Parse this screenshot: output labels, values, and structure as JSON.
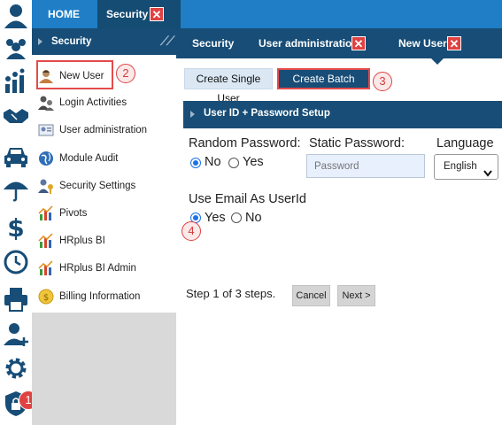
{
  "topbar": {
    "tabs": [
      {
        "label": "HOME"
      },
      {
        "label": "Security",
        "close": "✕"
      }
    ]
  },
  "sidebar": {
    "header": "Security",
    "items": [
      {
        "label": "New User",
        "icon": "user-icon"
      },
      {
        "label": "Login Activities",
        "icon": "users-icon"
      },
      {
        "label": "User administration",
        "icon": "id-card-icon"
      },
      {
        "label": "Module Audit",
        "icon": "globe-icon"
      },
      {
        "label": "Security Settings",
        "icon": "key-user-icon"
      },
      {
        "label": "Pivots",
        "icon": "chart-icon"
      },
      {
        "label": "HRplus BI",
        "icon": "chart-icon"
      },
      {
        "label": "HRplus BI Admin",
        "icon": "chart-icon"
      },
      {
        "label": "Billing Information",
        "icon": "coin-icon"
      }
    ]
  },
  "nav2": {
    "items": [
      {
        "label": "Security"
      },
      {
        "label": "User administration",
        "close": "✕"
      },
      {
        "label": "New User",
        "close": "✕"
      }
    ]
  },
  "content": {
    "create_single": "Create Single User",
    "create_batch": "Create Batch Users",
    "panel_title": "User ID + Password Setup",
    "random_password_label": "Random Password:",
    "random_no": "No",
    "random_yes": "Yes",
    "static_password_label": "Static Password:",
    "static_password_placeholder": "Password",
    "language_label": "Language",
    "language_value": "English",
    "use_email_label": "Use Email As UserId",
    "email_yes": "Yes",
    "email_no": "No",
    "step_text": "Step 1 of 3 steps.",
    "cancel": "Cancel",
    "next": "Next >"
  },
  "badges": {
    "one": "1",
    "two": "2",
    "three": "3",
    "four": "4"
  },
  "colors": {
    "accent": "#1f7ec6",
    "navy": "#174d77",
    "highlight": "#e34b4b"
  }
}
